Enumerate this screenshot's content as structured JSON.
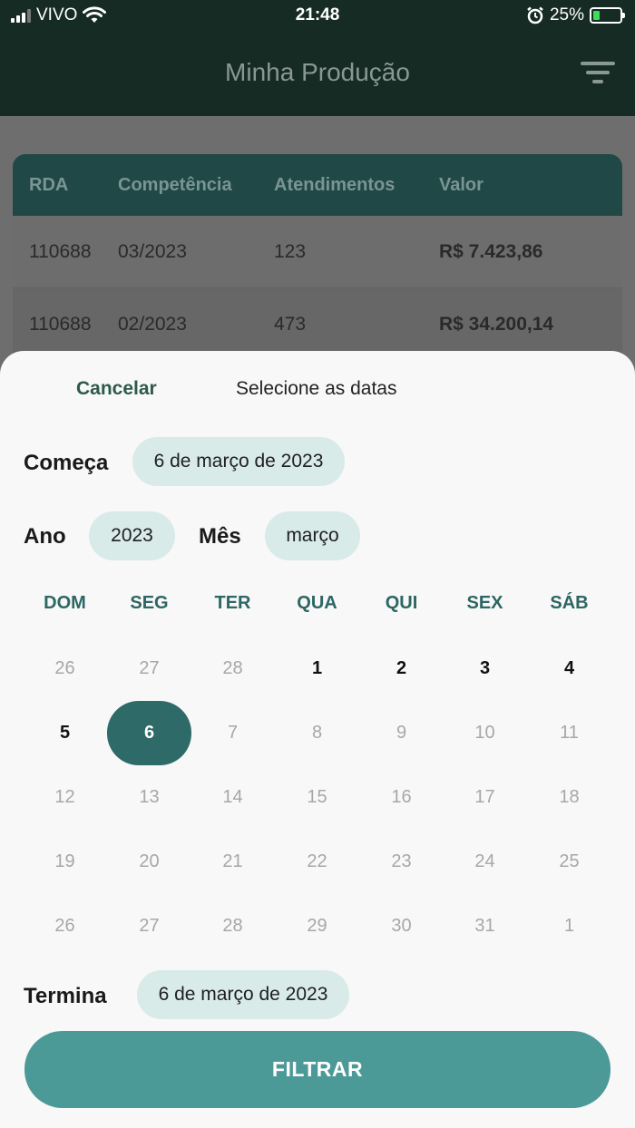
{
  "status_bar": {
    "carrier": "VIVO",
    "time": "21:48",
    "battery": "25%",
    "battery_level": 0.25,
    "icons": [
      "signal-icon",
      "wifi-icon",
      "alarm-icon",
      "battery-charging-icon"
    ]
  },
  "header": {
    "title": "Minha Produção",
    "filter_icon": "filter-icon"
  },
  "table": {
    "headers": [
      "RDA",
      "Competência",
      "Atendimentos",
      "Valor"
    ],
    "rows": [
      [
        "110688",
        "03/2023",
        "123",
        "R$ 7.423,86"
      ],
      [
        "110688",
        "02/2023",
        "473",
        "R$ 34.200,14"
      ]
    ]
  },
  "sheet": {
    "cancel_label": "Cancelar",
    "title": "Selecione as datas",
    "start_label": "Começa",
    "start_value": "6 de março de 2023",
    "year_label": "Ano",
    "year_value": "2023",
    "month_label": "Mês",
    "month_value": "março",
    "weekdays": [
      "DOM",
      "SEG",
      "TER",
      "QUA",
      "QUI",
      "SEX",
      "SÁB"
    ],
    "weeks": [
      [
        "26",
        "27",
        "28",
        "1",
        "2",
        "3",
        "4"
      ],
      [
        "5",
        "6",
        "7",
        "8",
        "9",
        "10",
        "11"
      ],
      [
        "12",
        "13",
        "14",
        "15",
        "16",
        "17",
        "18"
      ],
      [
        "19",
        "20",
        "21",
        "22",
        "23",
        "24",
        "25"
      ],
      [
        "26",
        "27",
        "28",
        "29",
        "30",
        "31",
        "1"
      ]
    ],
    "selected_day": "6",
    "end_label": "Termina",
    "end_value": "6 de março de 2023",
    "filter_button": "FILTRAR"
  },
  "colors": {
    "header_bg": "#162b24",
    "table_header_bg": "#1f4846",
    "accent": "#2e6a68",
    "pill_bg": "#d8ebe8",
    "filter_button_bg": "#4c9a98"
  }
}
